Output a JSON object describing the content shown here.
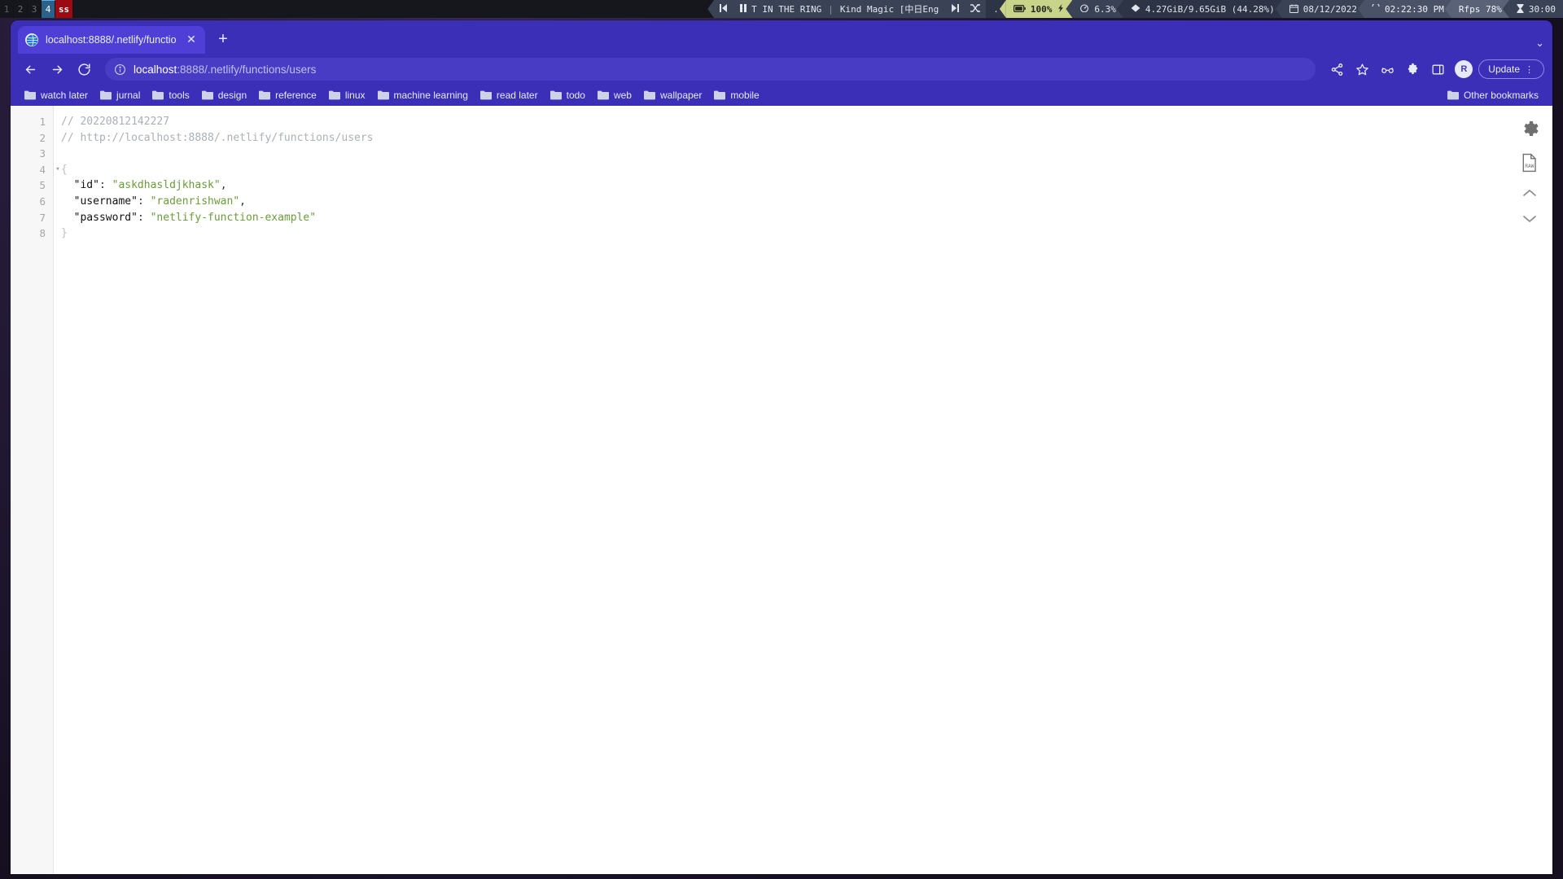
{
  "statusbar": {
    "workspaces": [
      {
        "label": "1",
        "state": "inactive"
      },
      {
        "label": "2",
        "state": "inactive"
      },
      {
        "label": "3",
        "state": "inactive"
      },
      {
        "label": "4",
        "state": "active"
      },
      {
        "label": "ss",
        "state": "urgent"
      }
    ],
    "media": {
      "prev_icon": "skip-previous-icon",
      "pause_icon": "pause-icon",
      "track": "T IN THE RING",
      "separator": "|",
      "artist": "Kind Magic [中日Eng",
      "next_icon": "skip-next-icon",
      "shuffle_icon": "shuffle-icon",
      "dot": "."
    },
    "battery": {
      "icon": "battery-icon",
      "value": "100%",
      "charging_icon": "plug-icon"
    },
    "cpu": {
      "icon": "speedometer-icon",
      "value": "6.3%"
    },
    "memory": {
      "icon": "memory-icon",
      "value": "4.27GiB/9.65GiB (44.28%)"
    },
    "date": {
      "icon": "calendar-icon",
      "value": "08/12/2022"
    },
    "time": {
      "icon": "clock-icon",
      "value": "02:22:30 PM"
    },
    "fps": {
      "value": "Rfps 78%"
    },
    "timer": {
      "icon": "hourglass-icon",
      "value": "30:00"
    },
    "colors": {
      "background": "#16171d",
      "accent_battery": "#c8d48a",
      "segment": "#3a4256",
      "active_workspace": "#2c6189",
      "urgent_workspace": "#9c0b12"
    }
  },
  "browser": {
    "tabs": [
      {
        "title": "localhost:8888/.netlify/functio",
        "favicon": "globe-icon",
        "close_icon": "close-icon"
      }
    ],
    "new_tab_icon": "plus-icon",
    "tabstrip_menu_icon": "chevron-down-icon",
    "toolbar": {
      "back_icon": "arrow-back-icon",
      "forward_icon": "arrow-forward-icon",
      "reload_icon": "reload-icon",
      "site_info_icon": "info-circle-icon",
      "url_host": "localhost",
      "url_rest": ":8888/.netlify/functions/users",
      "share_icon": "share-icon",
      "bookmark_icon": "star-icon",
      "extension_icon": "glasses-icon",
      "puzzle_icon": "puzzle-icon",
      "sidepanel_icon": "side-panel-icon",
      "avatar_label": "R",
      "update_label": "Update",
      "menu_icon": "kebab-menu-icon"
    },
    "bookmarks": {
      "items": [
        {
          "label": "watch later",
          "icon": "folder-icon"
        },
        {
          "label": "jurnal",
          "icon": "folder-icon"
        },
        {
          "label": "tools",
          "icon": "folder-icon"
        },
        {
          "label": "design",
          "icon": "folder-icon"
        },
        {
          "label": "reference",
          "icon": "folder-icon"
        },
        {
          "label": "linux",
          "icon": "folder-icon"
        },
        {
          "label": "machine learning",
          "icon": "folder-icon"
        },
        {
          "label": "read later",
          "icon": "folder-icon"
        },
        {
          "label": "todo",
          "icon": "folder-icon"
        },
        {
          "label": "web",
          "icon": "folder-icon"
        },
        {
          "label": "wallpaper",
          "icon": "folder-icon"
        },
        {
          "label": "mobile",
          "icon": "folder-icon"
        }
      ],
      "other": {
        "label": "Other bookmarks",
        "icon": "folder-icon"
      }
    }
  },
  "viewer": {
    "line_numbers": [
      "1",
      "2",
      "3",
      "4",
      "5",
      "6",
      "7",
      "8"
    ],
    "fold_marker": "▾",
    "lines": [
      {
        "n": "1",
        "type": "comment",
        "text": "// 20220812142227"
      },
      {
        "n": "2",
        "type": "comment",
        "text": "// http://localhost:8888/.netlify/functions/users"
      },
      {
        "n": "3",
        "type": "blank",
        "text": ""
      },
      {
        "n": "4",
        "type": "brace_open",
        "text": "{"
      },
      {
        "n": "5",
        "type": "pair",
        "key": "\"id\"",
        "sep": ": ",
        "value": "\"askdhasldjkhask\"",
        "tail": ","
      },
      {
        "n": "6",
        "type": "pair",
        "key": "\"username\"",
        "sep": ": ",
        "value": "\"radenrishwan\"",
        "tail": ","
      },
      {
        "n": "7",
        "type": "pair",
        "key": "\"password\"",
        "sep": ": ",
        "value": "\"netlify-function-example\"",
        "tail": ""
      },
      {
        "n": "8",
        "type": "brace_close",
        "text": "}"
      }
    ],
    "raw_label": "RAW",
    "tools": {
      "settings_icon": "gear-icon",
      "raw_icon": "raw-document-icon",
      "up_icon": "chevron-up-icon",
      "down_icon": "chevron-down-icon"
    },
    "colors": {
      "string": "#6a9c3c",
      "comment": "#aab0b6",
      "key": "#111111",
      "background": "#ffffff"
    }
  }
}
